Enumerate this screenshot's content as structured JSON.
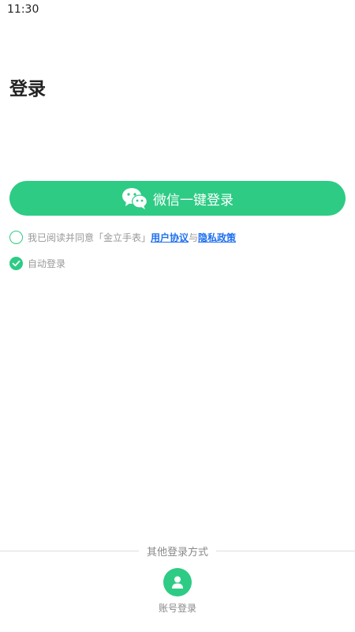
{
  "status_bar": {
    "time": "11:30"
  },
  "page": {
    "title": "登录"
  },
  "wechat_login": {
    "label": "微信一键登录",
    "icon": "wechat-icon",
    "color": "#2ecb85"
  },
  "agreement": {
    "checked": false,
    "prefix": "我已阅读并同意「金立手表」",
    "user_agreement": "用户协议",
    "conjunction": "与",
    "privacy_policy": "隐私政策",
    "link_color": "#1e6ff0"
  },
  "auto_login": {
    "checked": true,
    "label": "自动登录"
  },
  "other_methods": {
    "label": "其他登录方式",
    "account_login": {
      "label": "账号登录",
      "icon": "user-icon"
    }
  }
}
